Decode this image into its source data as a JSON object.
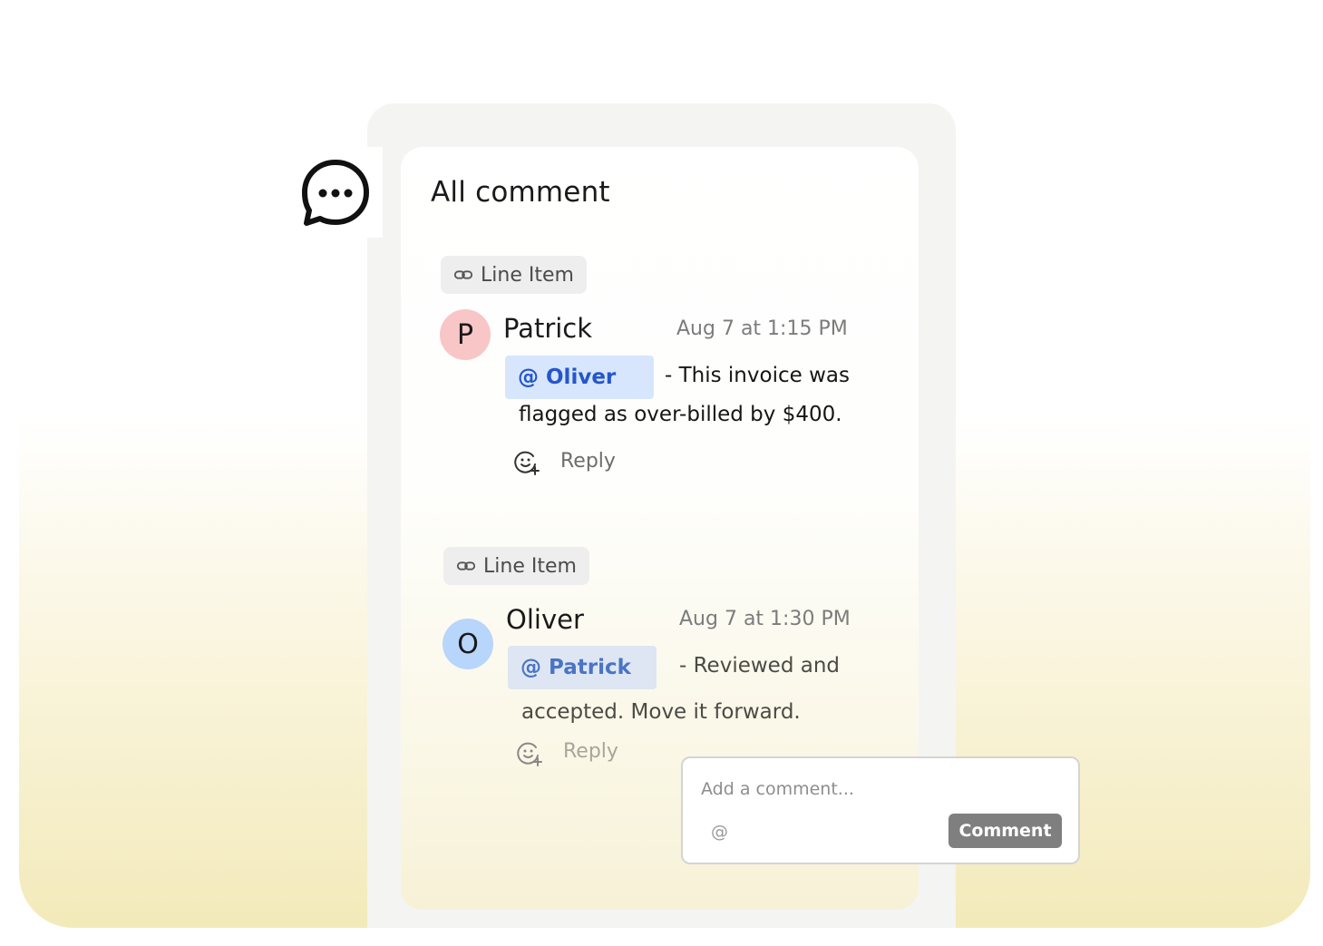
{
  "panel": {
    "title": "All comment"
  },
  "icons": {
    "chat": "chat-bubble-ellipsis-icon",
    "link": "link-icon",
    "emoji_add": "emoji-add-icon"
  },
  "colors": {
    "mention_text": "#2456cc",
    "mention_bg": "#d7e6fd",
    "avatar_p": "#f8c6c6",
    "avatar_o": "#b8d5fb",
    "comment_button": "#7f7f7f"
  },
  "comments": [
    {
      "tag": "Line Item",
      "avatar_letter": "P",
      "author": "Patrick",
      "time": "Aug 7 at 1:15 PM",
      "mention": "@ Oliver",
      "text_line1": "- This invoice was",
      "text_line2": "flagged as over-billed by $400.",
      "reply": "Reply"
    },
    {
      "tag": "Line Item",
      "avatar_letter": "O",
      "author": "Oliver",
      "time": "Aug 7 at 1:30 PM",
      "mention": "@ Patrick",
      "text_line1": "- Reviewed and",
      "text_line2": "accepted. Move it forward.",
      "reply": "Reply"
    }
  ],
  "composer": {
    "placeholder": "Add a comment...",
    "at_symbol": "@",
    "button": "Comment"
  }
}
